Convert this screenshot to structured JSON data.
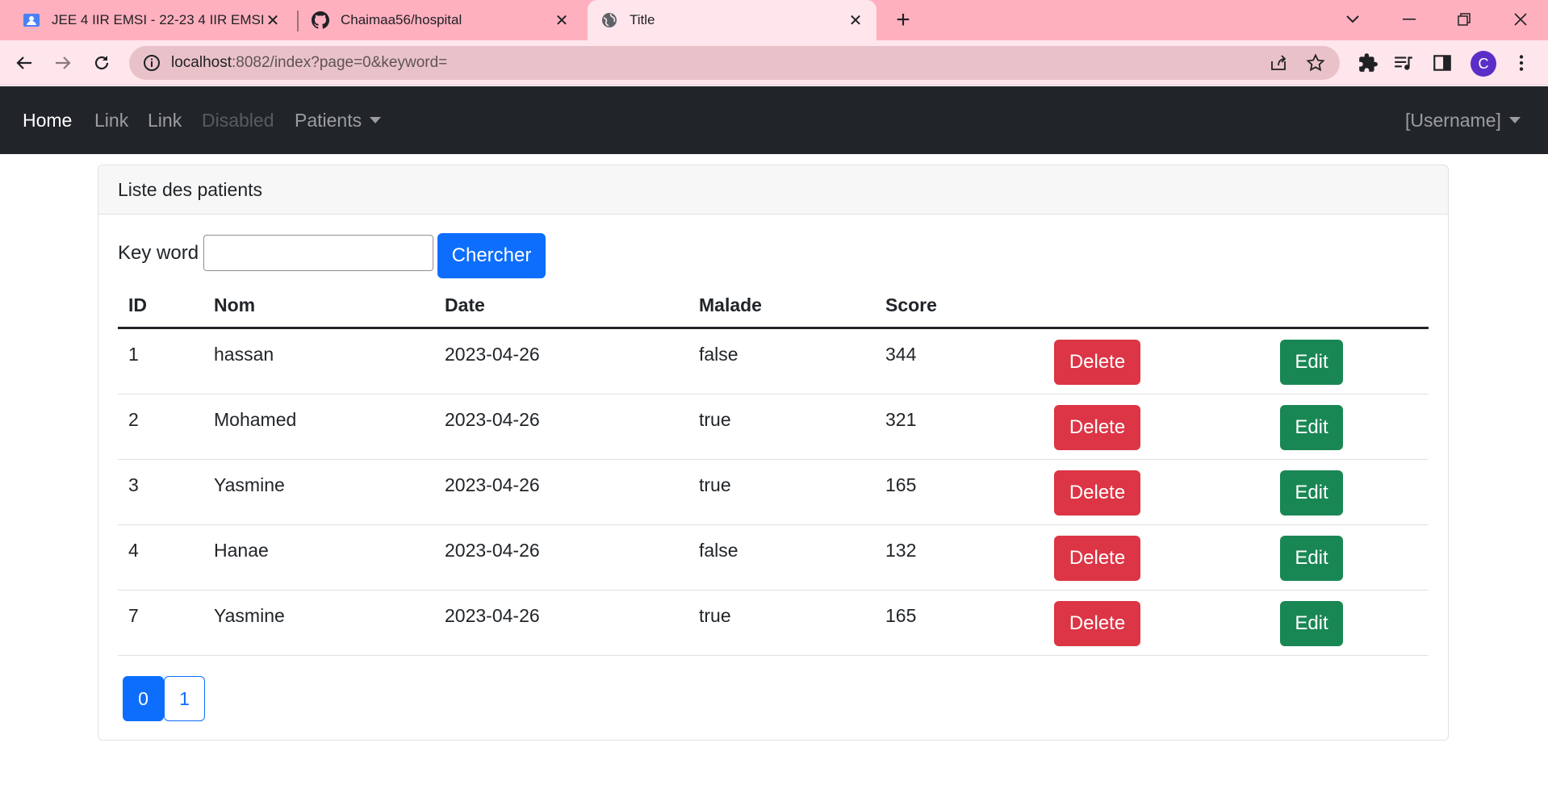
{
  "browser": {
    "tabs": [
      {
        "title": "JEE 4 IIR EMSI - 22-23 4 IIR EMSI",
        "icon": "classroom-icon",
        "active": false
      },
      {
        "title": "Chaimaa56/hospital",
        "icon": "github-icon",
        "active": false
      },
      {
        "title": "Title",
        "icon": "globe-icon",
        "active": true
      }
    ],
    "url_host": "localhost",
    "url_rest": ":8082/index?page=0&keyword=",
    "profile_initial": "C"
  },
  "navbar": {
    "links": [
      {
        "label": "Home",
        "state": "active"
      },
      {
        "label": "Link",
        "state": "normal"
      },
      {
        "label": "Link",
        "state": "normal"
      },
      {
        "label": "Disabled",
        "state": "disabled"
      }
    ],
    "dropdown_label": "Patients",
    "user_label": "[Username]"
  },
  "card": {
    "title": "Liste des patients",
    "search": {
      "label": "Key word",
      "value": "",
      "button_label": "Chercher"
    }
  },
  "table": {
    "headers": [
      "ID",
      "Nom",
      "Date",
      "Malade",
      "Score"
    ],
    "rows": [
      {
        "id": "1",
        "nom": "hassan",
        "date": "2023-04-26",
        "malade": "false",
        "score": "344"
      },
      {
        "id": "2",
        "nom": "Mohamed",
        "date": "2023-04-26",
        "malade": "true",
        "score": "321"
      },
      {
        "id": "3",
        "nom": "Yasmine",
        "date": "2023-04-26",
        "malade": "true",
        "score": "165"
      },
      {
        "id": "4",
        "nom": "Hanae",
        "date": "2023-04-26",
        "malade": "false",
        "score": "132"
      },
      {
        "id": "7",
        "nom": "Yasmine",
        "date": "2023-04-26",
        "malade": "true",
        "score": "165"
      }
    ],
    "delete_label": "Delete",
    "edit_label": "Edit"
  },
  "pagination": {
    "pages": [
      "0",
      "1"
    ],
    "current": "0"
  },
  "colors": {
    "primary": "#0d6efd",
    "danger": "#dc3545",
    "success": "#198754",
    "navbar": "#212529",
    "tabbar": "#ffb0bf"
  }
}
